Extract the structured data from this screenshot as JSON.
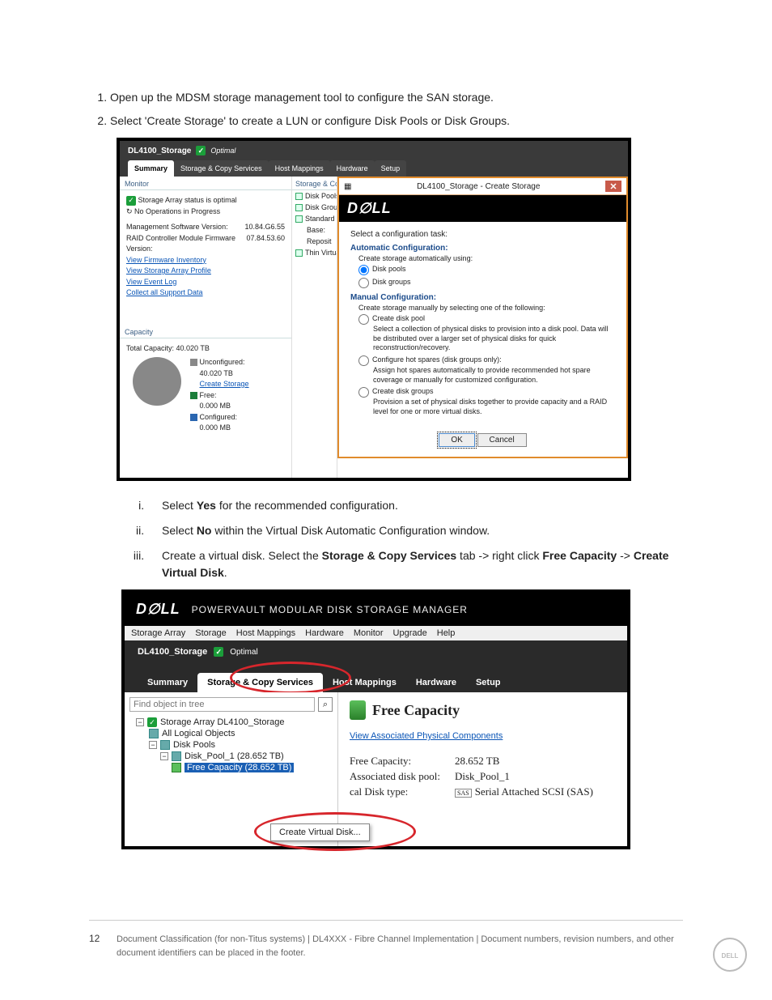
{
  "steps": {
    "s1": "Open up the MDSM storage management tool to configure the SAN storage.",
    "s2": "Select 'Create Storage' to create a LUN or configure Disk Pools or Disk Groups."
  },
  "mdsm1": {
    "title": "DL4100_Storage",
    "optimal": "Optimal",
    "tabs": {
      "summary": "Summary",
      "scs": "Storage & Copy Services",
      "host": "Host Mappings",
      "hw": "Hardware",
      "setup": "Setup"
    },
    "monitor": {
      "heading": "Monitor",
      "status": "Storage Array status is optimal",
      "noops": "No Operations in Progress",
      "mgmt_label": "Management Software Version:",
      "mgmt_val": "10.84.G6.55",
      "fw_label": "RAID Controller Module Firmware Version:",
      "fw_val": "07.84.53.60",
      "link_fw": "View Firmware Inventory",
      "link_profile": "View Storage Array Profile",
      "link_event": "View Event Log",
      "link_support": "Collect all Support Data"
    },
    "capacity": {
      "heading": "Capacity",
      "total": "Total Capacity: 40.020 TB",
      "unconf_label": "Unconfigured:",
      "unconf_val": "40.020 TB",
      "create_link": "Create Storage",
      "free_label": "Free:",
      "free_val": "0.000 MB",
      "conf_label": "Configured:",
      "conf_val": "0.000 MB"
    },
    "mid": {
      "heading": "Storage & Cop",
      "i1": "Disk Pools",
      "i2": "Disk Group",
      "i3": "Standard V",
      "i4": "Base:",
      "i5": "Reposit",
      "i6": "Thin Virtua"
    }
  },
  "dialog": {
    "title": "DL4100_Storage - Create Storage",
    "intro": "Select a configuration task:",
    "auto_h": "Automatic Configuration:",
    "auto_sub": "Create storage automatically using:",
    "r_diskpools": "Disk pools",
    "r_diskgroups": "Disk groups",
    "man_h": "Manual Configuration:",
    "man_sub": "Create storage manually by selecting one of the following:",
    "r_cdp": "Create disk pool",
    "r_cdp_desc": "Select a collection of physical disks to provision into a disk pool. Data will be distributed over a larger set of physical disks for quick reconstruction/recovery.",
    "r_chs": "Configure hot spares (disk groups only):",
    "r_chs_desc": "Assign hot spares automatically to provide recommended hot spare coverage or manually for customized configuration.",
    "r_cdg": "Create disk groups",
    "r_cdg_desc": "Provision a set of physical disks together to provide capacity and a RAID level for one or more virtual disks.",
    "ok": "OK",
    "cancel": "Cancel"
  },
  "substeps": {
    "i_pre": "Select ",
    "i_bold": "Yes",
    "i_post": " for the recommended configuration.",
    "ii_pre": "Select ",
    "ii_bold": "No",
    "ii_post": " within the Virtual Disk Automatic Configuration window.",
    "iii_pre": "Create a virtual disk.  Select the ",
    "iii_b1": "Storage & Copy Services",
    "iii_mid": " tab -> right click ",
    "iii_b2": "Free Capacity",
    "iii_post": " -> ",
    "iii_b3": "Create Virtual Disk",
    "iii_dot": "."
  },
  "mdsm2": {
    "suite": "POWERVAULT MODULAR DISK STORAGE MANAGER",
    "menu": {
      "m1": "Storage Array",
      "m2": "Storage",
      "m3": "Host Mappings",
      "m4": "Hardware",
      "m5": "Monitor",
      "m6": "Upgrade",
      "m7": "Help"
    },
    "array_title": "DL4100_Storage",
    "opt": "Optimal",
    "tabs": {
      "summary": "Summary",
      "scs": "Storage & Copy Services",
      "host": "Host Mappings",
      "hw": "Hardware",
      "setup": "Setup"
    },
    "search_placeholder": "Find object in tree",
    "tree": {
      "root": "Storage Array DL4100_Storage",
      "all": "All Logical Objects",
      "pools": "Disk Pools",
      "pool1": "Disk_Pool_1 (28.652 TB)",
      "free": "Free Capacity (28.652 TB)"
    },
    "context_menu": "Create Virtual Disk...",
    "info": {
      "title": "Free Capacity",
      "view_link": "View Associated Physical Components",
      "fc_label": "Free Capacity:",
      "fc_val": "28.652 TB",
      "pool_label": "Associated disk pool:",
      "pool_val": "Disk_Pool_1",
      "type_label_frag": "cal Disk type:",
      "type_badge": "SAS",
      "type_val": "Serial Attached SCSI (SAS)"
    }
  },
  "footer": {
    "page": "12",
    "text": "Document Classification (for non-Titus systems) | DL4XXX - Fibre Channel Implementation | Document numbers, revision numbers, and other document identifiers can be placed in the footer."
  }
}
